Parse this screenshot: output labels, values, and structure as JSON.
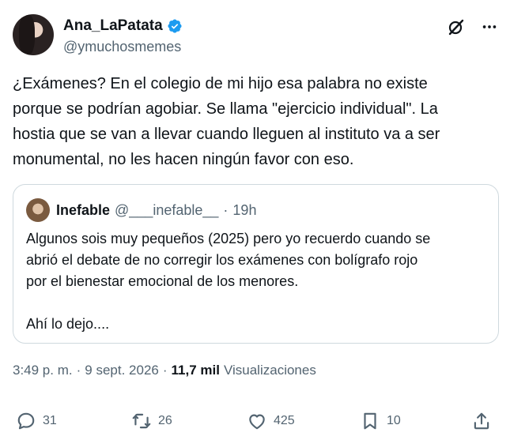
{
  "tweet": {
    "author": {
      "display_name": "Ana_LaPatata",
      "handle": "@ymuchosmemes",
      "verified": true,
      "verified_color": "#1d9bf0"
    },
    "text": "¿Exámenes? En el colegio de mi hijo esa palabra no existe\nporque se podrían agobiar. Se llama \"ejercicio individual\". La\nhostia que se van a llevar cuando lleguen al instituto va a ser\nmonumental, no les hacen ningún favor con eso.",
    "top_icons": [
      "grok-icon",
      "more-icon"
    ],
    "quote": {
      "display_name": "Inefable",
      "handle": "@___inefable__",
      "separator": "·",
      "time": "19h",
      "text": "Algunos sois muy pequeños (2025) pero yo recuerdo cuando se\nabrió el debate de no corregir los exámenes con bolígrafo rojo\npor el bienestar emocional de los menores.\n\nAhí lo dejo...."
    },
    "meta": {
      "time": "3:49 p. m.",
      "separator1": "·",
      "date": "9 sept. 2026",
      "separator2": "·",
      "views_count": "11,7 mil",
      "views_label": "Visualizaciones"
    },
    "actions": {
      "replies": "31",
      "retweets": "26",
      "likes": "425",
      "bookmarks": "10"
    }
  }
}
